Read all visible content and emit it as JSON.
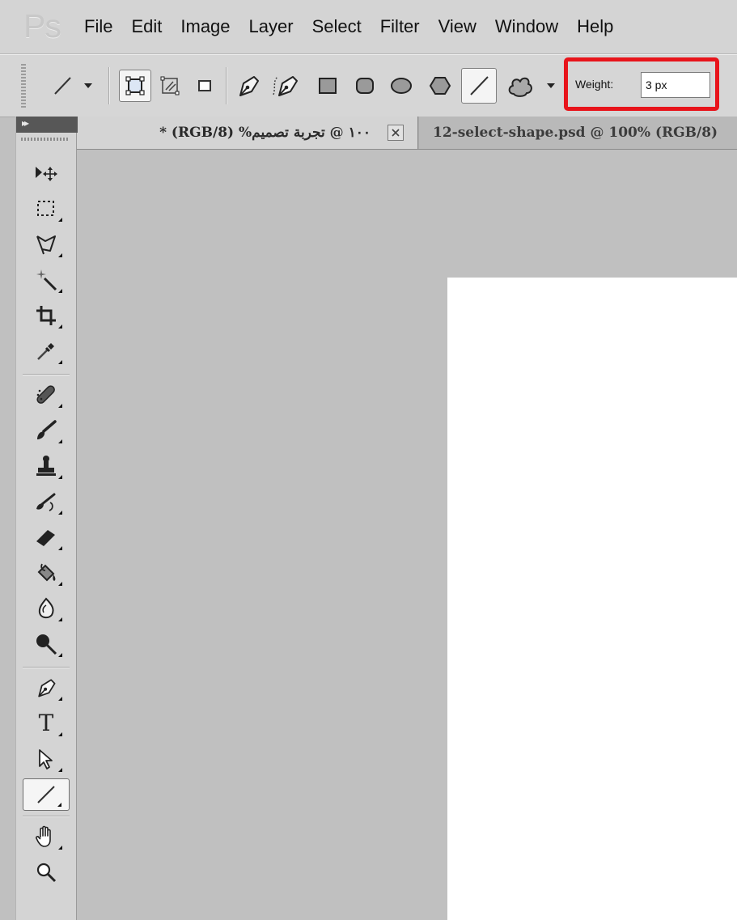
{
  "app": {
    "logo_text": "Ps"
  },
  "menu": {
    "items": [
      "File",
      "Edit",
      "Image",
      "Layer",
      "Select",
      "Filter",
      "View",
      "Window",
      "Help"
    ]
  },
  "options_bar": {
    "current_tool_icon": "line-icon",
    "shape_mode_icons": [
      "shape-layers-icon",
      "paths-icon",
      "fill-pixels-icon"
    ],
    "shape_tool_icons": [
      "pen-icon",
      "freeform-pen-icon",
      "rectangle-icon",
      "rounded-rectangle-icon",
      "ellipse-icon",
      "polygon-icon",
      "line-icon",
      "custom-shape-icon"
    ],
    "weight_label": "Weight:",
    "weight_value": "3 px",
    "highlight_color": "#e8141b"
  },
  "tabs": {
    "active": {
      "title": "١٠٠ @ تجربة تصميم% (RGB/8) *"
    },
    "inactive": {
      "title": "12-select-shape.psd @ 100% (RGB/8)"
    }
  },
  "toolbox": {
    "tools": [
      "move-tool-icon",
      "marquee-tool-icon",
      "lasso-tool-icon",
      "magic-wand-tool-icon",
      "crop-tool-icon",
      "eyedropper-tool-icon",
      "healing-brush-tool-icon",
      "brush-tool-icon",
      "clone-stamp-tool-icon",
      "history-brush-tool-icon",
      "eraser-tool-icon",
      "paint-bucket-tool-icon",
      "blur-tool-icon",
      "dodge-tool-icon",
      "pen-tool-icon",
      "type-tool-icon",
      "path-selection-tool-icon",
      "line-tool-icon",
      "hand-tool-icon",
      "zoom-tool-icon"
    ],
    "type_tool_glyph": "T",
    "selected_tool": "line-tool-icon"
  },
  "colors": {
    "workspace": "#c0c0c0",
    "canvas": "#ffffff",
    "chrome": "#d4d4d4"
  }
}
